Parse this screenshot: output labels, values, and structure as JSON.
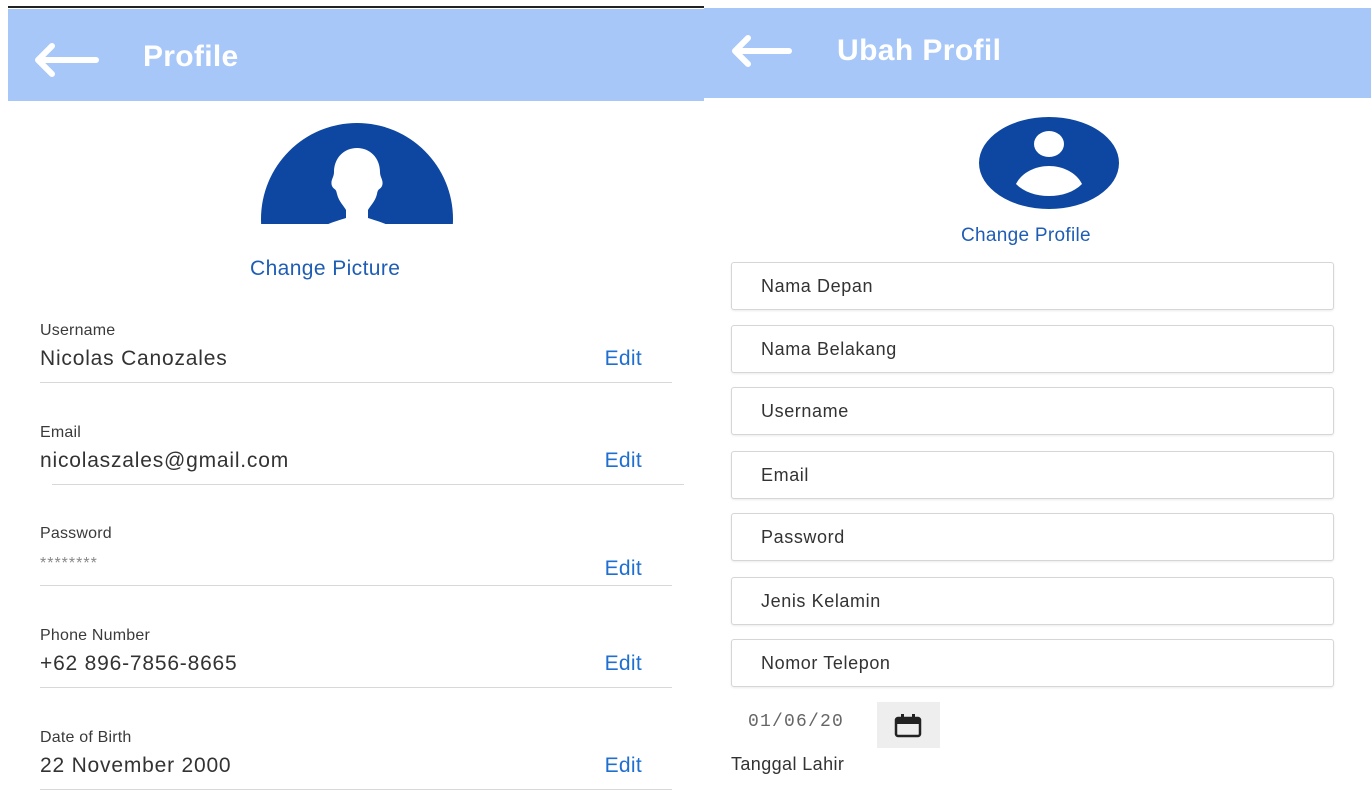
{
  "left_screen": {
    "header": {
      "title": "Profile"
    },
    "change_picture_label": "Change Picture",
    "fields": [
      {
        "label": "Username",
        "value": "Nicolas Canozales",
        "edit_label": "Edit"
      },
      {
        "label": "Email",
        "value": "nicolaszales@gmail.com",
        "edit_label": "Edit"
      },
      {
        "label": "Password",
        "value": "********",
        "edit_label": "Edit"
      },
      {
        "label": "Phone Number",
        "value": "+62 896-7856-8665",
        "edit_label": "Edit"
      },
      {
        "label": "Date of Birth",
        "value": "22 November 2000",
        "edit_label": "Edit"
      }
    ]
  },
  "right_screen": {
    "header": {
      "title": "Ubah Profil"
    },
    "change_profile_label": "Change Profile",
    "inputs": {
      "first_name_placeholder": "Nama Depan",
      "last_name_placeholder": "Nama Belakang",
      "username_placeholder": "Username",
      "email_placeholder": "Email",
      "password_placeholder": "Password",
      "gender_placeholder": "Jenis Kelamin",
      "phone_placeholder": "Nomor Telepon"
    },
    "date": {
      "value": "01/06/20",
      "label": "Tanggal Lahir"
    }
  },
  "colors": {
    "header_bg": "#a7c7f9",
    "avatar_blue": "#0d47a1",
    "link_blue": "#1f5db5",
    "edit_blue": "#1f6fd1"
  },
  "icons": {
    "back": "arrow-left-icon",
    "avatar": "person-silhouette-icon",
    "avatar_round": "account-circle-icon",
    "date": "calendar-icon"
  }
}
